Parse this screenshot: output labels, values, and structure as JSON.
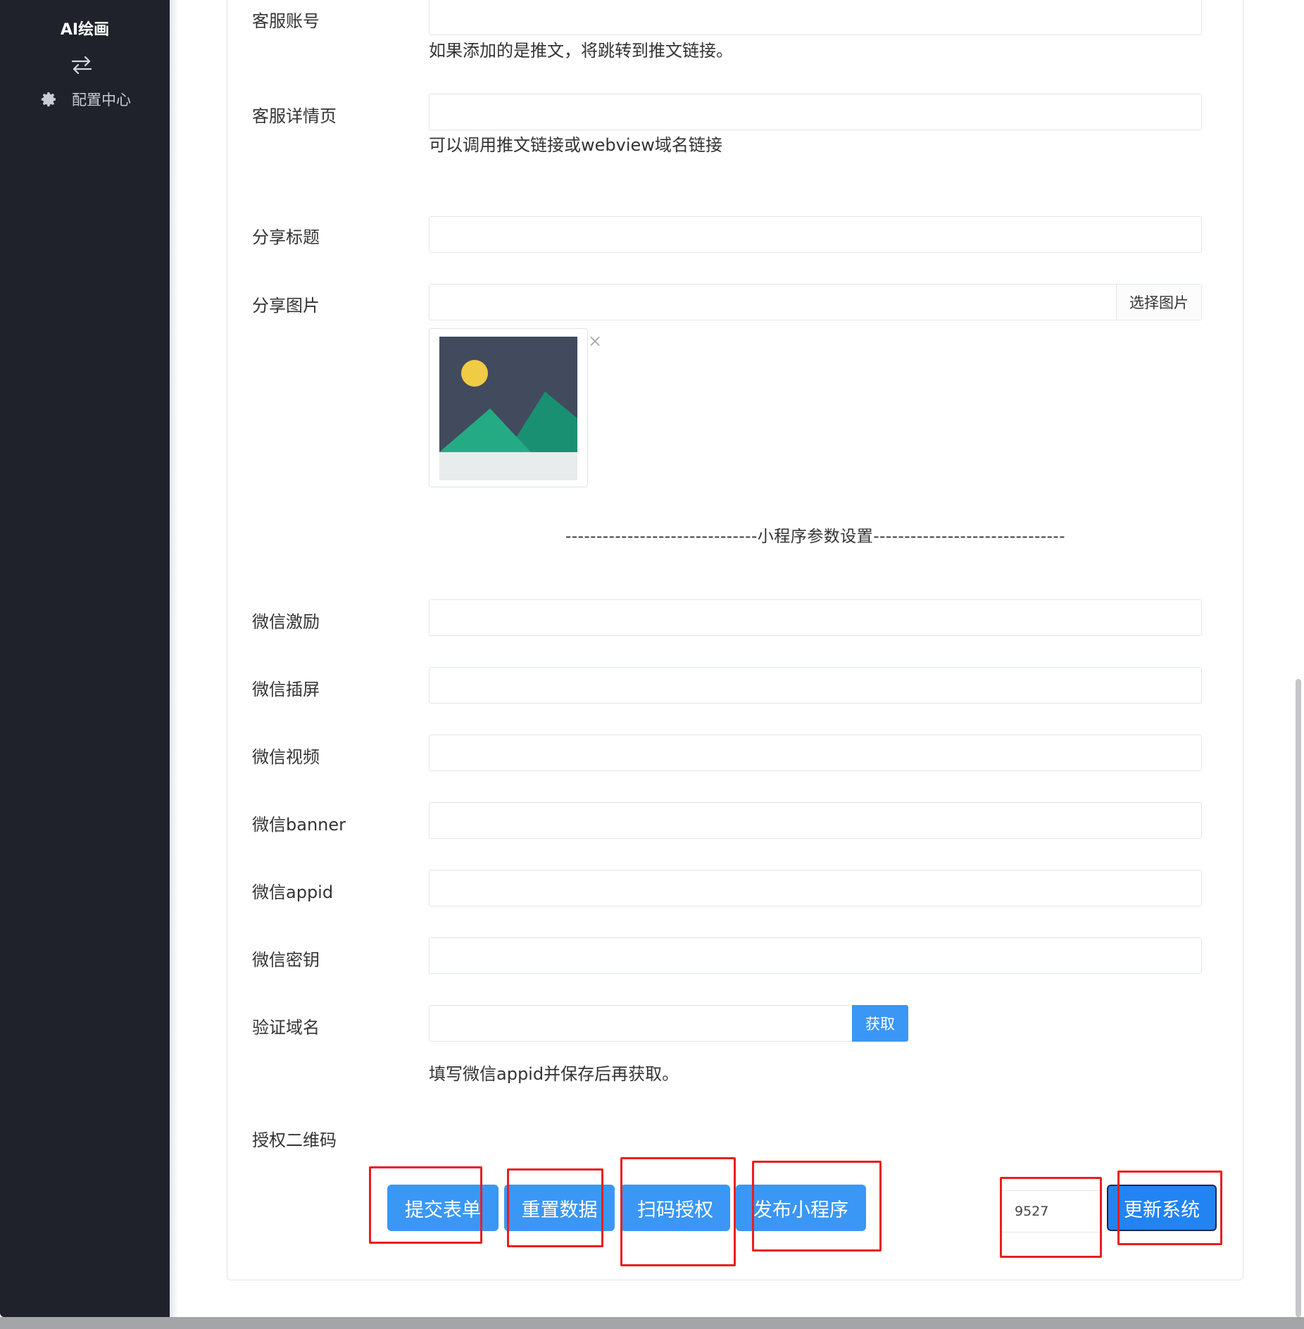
{
  "app": {
    "brand": "AI绘画"
  },
  "sidebar": {
    "toggle_icon": "swap-arrows-icon",
    "items": [
      {
        "label": "配置中心",
        "icon": "gear-icon"
      }
    ]
  },
  "form": {
    "service_account": {
      "label": "客服账号",
      "value": "",
      "help": "如果添加的是推文，将跳转到推文链接。"
    },
    "service_detail": {
      "label": "客服详情页",
      "value": "",
      "help": "可以调用推文链接或webview域名链接"
    },
    "share_title": {
      "label": "分享标题",
      "value": ""
    },
    "share_image": {
      "label": "分享图片",
      "value": "",
      "button": "选择图片",
      "remove": "×"
    },
    "divider": "-------------------------------小程序参数设置-------------------------------",
    "wx_incentive": {
      "label": "微信激励",
      "value": ""
    },
    "wx_interstitial": {
      "label": "微信插屏",
      "value": ""
    },
    "wx_video": {
      "label": "微信视频",
      "value": ""
    },
    "wx_banner": {
      "label": "微信banner",
      "value": ""
    },
    "wx_appid": {
      "label": "微信appid",
      "value": ""
    },
    "wx_secret": {
      "label": "微信密钥",
      "value": ""
    },
    "verify_domain": {
      "label": "验证域名",
      "value": "",
      "button": "获取",
      "help": "填写微信appid并保存后再获取。"
    },
    "auth_qrcode": {
      "label": "授权二维码"
    }
  },
  "actions": {
    "submit": "提交表单",
    "reset": "重置数据",
    "scan_auth": "扫码授权",
    "publish": "发布小程序",
    "version": "9527",
    "update": "更新系统"
  },
  "colors": {
    "primary": "#3a97f5",
    "sidebar": "#1f222b",
    "highlight": "#ea1e1e"
  }
}
